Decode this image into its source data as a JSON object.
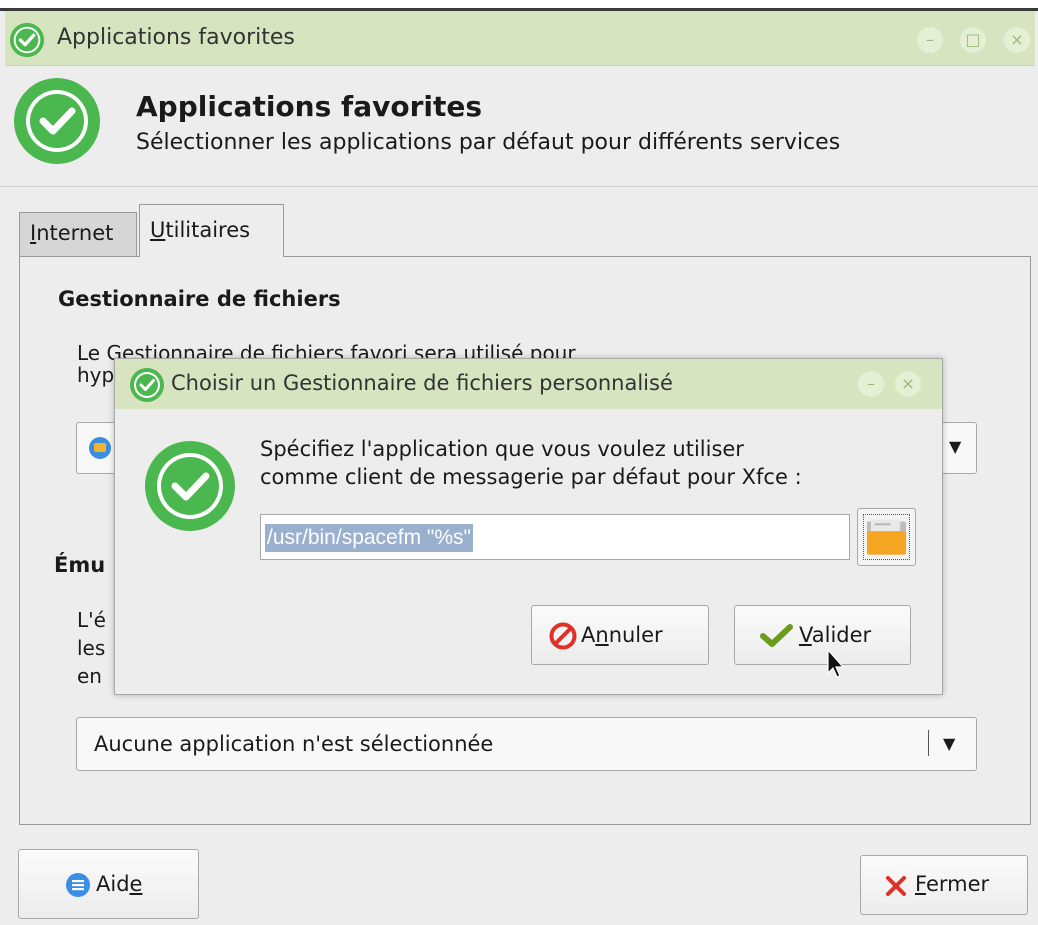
{
  "window": {
    "title": "Applications favorites"
  },
  "header": {
    "title": "Applications favorites",
    "subtitle": "Sélectionner les applications par défaut pour différents services"
  },
  "tabs": [
    {
      "label": "Internet",
      "mnemonic": "I",
      "rest": "nternet",
      "active": false
    },
    {
      "label": "Utilitaires",
      "mnemonic": "U",
      "rest": "tilitaires",
      "active": true
    }
  ],
  "file_manager": {
    "title": "Gestionnaire de fichiers",
    "description_line1": "Le Gestionnaire de fichiers favori sera utilisé pour",
    "description_line2_prefix": "hyp",
    "combo_value": ""
  },
  "terminal": {
    "title_prefix": "Ému",
    "desc_prefix_1": "L'é",
    "desc_prefix_2": "les",
    "desc_prefix_3": "en",
    "combo_value": "Aucune application n'est sélectionnée"
  },
  "buttons": {
    "help": {
      "before": "Aid",
      "mnemonic": "e",
      "after": ""
    },
    "close": {
      "before": "",
      "mnemonic": "F",
      "after": "ermer"
    }
  },
  "dialog": {
    "title": "Choisir un Gestionnaire de fichiers personnalisé",
    "message_line1": "Spécifiez l'application que vous voulez utiliser",
    "message_line2": "comme client de messagerie par défaut pour Xfce :",
    "command_value": "/usr/bin/spacefm \"%s\"",
    "cancel": {
      "before": "A",
      "mnemonic": "n",
      "after": "nuler"
    },
    "ok": {
      "before": "",
      "mnemonic": "V",
      "after": "alider"
    }
  },
  "icons": {
    "app": "check-circle-icon",
    "help": "help-icon",
    "close": "close-icon",
    "cancel": "cancel-icon",
    "ok": "checkmark-icon",
    "browse": "folder-icon"
  },
  "colors": {
    "titlebar": "#d6e4bf",
    "accent_green": "#4bb84f",
    "selection": "#9ab0cf"
  }
}
